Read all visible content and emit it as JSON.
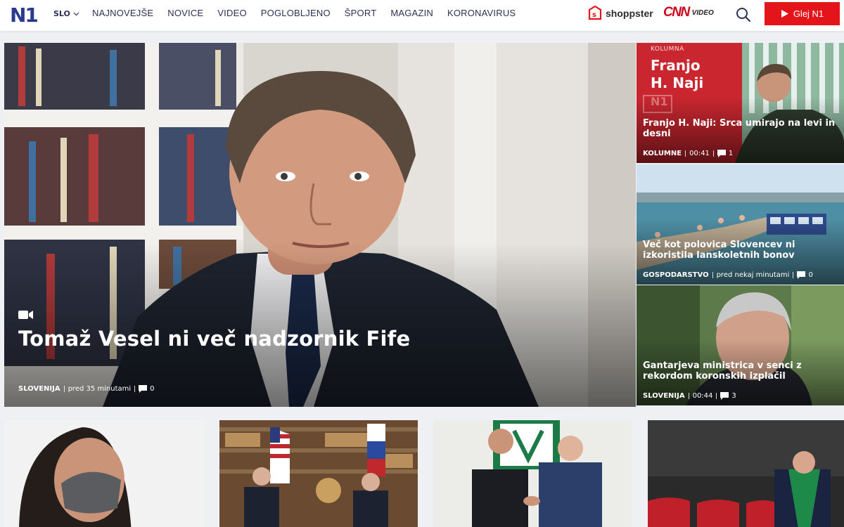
{
  "header": {
    "logo": "N1",
    "language": "SLO",
    "nav": [
      "NAJNOVEJŠE",
      "NOVICE",
      "VIDEO",
      "POGLOBLJENO",
      "ŠPORT",
      "MAGAZIN",
      "KORONAVIRUS"
    ],
    "shoppster": "shoppster",
    "cnn_logo": "CNN",
    "cnn_video": "VIDEO",
    "watch_button": "Glej N1",
    "accent_color": "#e3151a",
    "brand_color": "#2b3256"
  },
  "hero": {
    "title": "Tomaž Vesel ni več nadzornik Fife",
    "category": "SLOVENIJA",
    "time": "pred 35 minutami",
    "comments": "0",
    "icon": "video-camera-icon"
  },
  "side": [
    {
      "label": "KOLUMNA",
      "name_line1": "Franjo",
      "name_line2": "H. Naji",
      "badge": "N1",
      "title": "Franjo H. Naji: Srca umirajo na levi in desni",
      "category": "KOLUMNE",
      "time": "00:41",
      "comments": "1"
    },
    {
      "title": "Več kot polovica Slovencev ni izkoristila lanskoletnih bonov",
      "category": "GOSPODARSTVO",
      "time": "pred nekaj minutami",
      "comments": "0"
    },
    {
      "title": "Gantarjeva ministrica v senci z rekordom koronskih izplačil",
      "category": "SLOVENIJA",
      "time": "00:44",
      "comments": "3"
    }
  ]
}
